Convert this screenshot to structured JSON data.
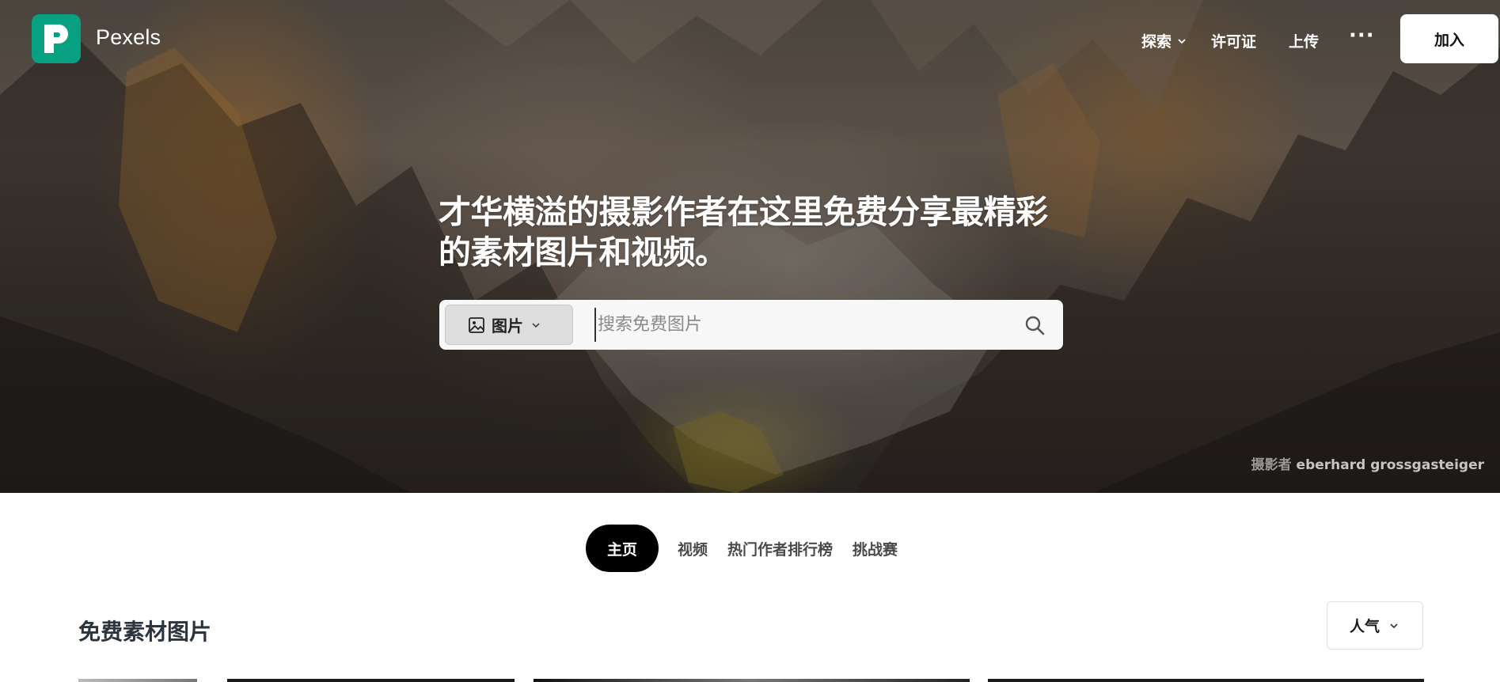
{
  "header": {
    "brand": "Pexels",
    "nav": {
      "explore": "探索",
      "license": "许可证",
      "upload": "上传",
      "more": "···"
    },
    "join_label": "加入"
  },
  "hero": {
    "headline_line1": "才华横溢的摄影作者在这里免费分享最精彩",
    "headline_line2": "的素材图片和视频。",
    "search": {
      "type_label": "图片",
      "placeholder": "搜索免费图片"
    },
    "credit_prefix": "摄影者",
    "credit_name": "eberhard grossgasteiger"
  },
  "tabs": [
    {
      "label": "主页",
      "active": true
    },
    {
      "label": "视频"
    },
    {
      "label": "热门作者排行榜"
    },
    {
      "label": "挑战赛"
    }
  ],
  "section": {
    "title": "免费素材图片",
    "sort_label": "人气"
  },
  "colors": {
    "brand": "#07a081",
    "tab_active_bg": "#000000",
    "text_dark": "#2c343e"
  },
  "icons": {
    "logo": "pexels-logo-icon",
    "explore_chevron": "chevron-down-icon",
    "more": "ellipsis-icon",
    "type_select_icon": "image-icon",
    "type_select_chevron": "chevron-down-icon",
    "search": "search-icon",
    "sort_chevron": "chevron-down-icon"
  }
}
